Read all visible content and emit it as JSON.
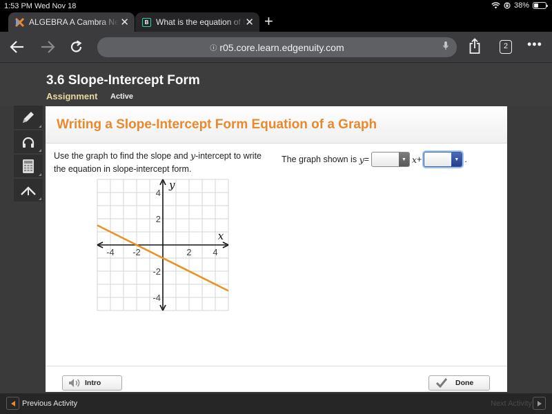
{
  "status_bar": {
    "time": "1:53 PM",
    "date": "Wed Nov 18",
    "battery_text": "38%",
    "battery_level": 0.38,
    "icons": [
      "wifi-icon",
      "orientation-lock-icon",
      "battery-icon"
    ]
  },
  "browser": {
    "tabs": [
      {
        "title": "ALGEBRA A Cambra New",
        "favicon": "edgenuity-icon",
        "active": true
      },
      {
        "title": "What is the equation of the",
        "favicon": "brainly-icon",
        "favicon_letter": "B",
        "active": false
      }
    ],
    "new_tab_label": "+",
    "url": "r05.core.learn.edgenuity.com",
    "tab_count": "2"
  },
  "page_header": {
    "lesson_title": "3.6 Slope-Intercept Form",
    "type": "Assignment",
    "status": "Active"
  },
  "tools": [
    {
      "name": "pencil",
      "icon": "pencil-icon"
    },
    {
      "name": "audio",
      "icon": "headphones-icon"
    },
    {
      "name": "calculator",
      "icon": "calculator-icon"
    },
    {
      "name": "formula",
      "icon": "caret-up-icon"
    }
  ],
  "activity": {
    "title": "Writing a Slope-Intercept Form Equation of a Graph",
    "instructions": {
      "before": "Use the graph to find the slope and ",
      "var": "y",
      "after": "-intercept to write the equation in slope-intercept form."
    },
    "equation": {
      "prefix": "The graph shown is ",
      "lhs_var": "y",
      "equals": " =",
      "x_var": "x",
      "plus": " +",
      "suffix": ".",
      "slope_dropdown_value": "",
      "intercept_dropdown_value": ""
    },
    "graph": {
      "xlim": [
        -5,
        5
      ],
      "ylim": [
        -5,
        5
      ],
      "x_ticks": [
        "-4",
        "-2",
        "2",
        "4"
      ],
      "y_ticks": [
        "4",
        "2",
        "-2",
        "-4"
      ],
      "x_label": "x",
      "y_label": "y",
      "line_color": "#e8931f",
      "line_slope": -0.5,
      "line_intercept": -1
    },
    "buttons": {
      "intro": "Intro",
      "done": "Done"
    }
  },
  "bottom_nav": {
    "previous": "Previous Activity",
    "next": "Next Activity"
  },
  "colors": {
    "accent_orange": "#e8892e",
    "assignment_label": "#e8d9a0",
    "focus_blue": "#2f4f9e"
  }
}
